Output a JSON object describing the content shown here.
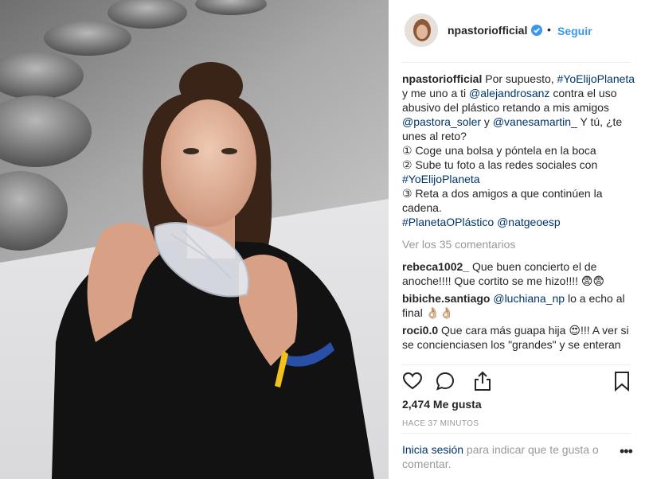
{
  "header": {
    "username": "npastoriofficial",
    "separator": "•",
    "follow_label": "Seguir"
  },
  "caption": {
    "username": "npastoriofficial",
    "text_1": " Por supuesto, ",
    "tag_1": "#YoElijoPlaneta",
    "text_2": " y me uno a ti ",
    "mention_1": "@alejandrosanz",
    "text_3": " contra el uso abusivo del plástico retando a mis amigos ",
    "mention_2": "@pastora_soler",
    "text_4": " y ",
    "mention_3": "@vanesamartin_",
    "text_5": " Y tú, ¿te unes al reto?",
    "step_1": "① Coge una bolsa y póntela en la boca",
    "step_2a": "② Sube tu foto a las redes sociales con ",
    "step_2_tag": "#YoElijoPlaneta",
    "step_3": "③ Reta a dos amigos a que continúen la cadena.",
    "tag_2": "#PlanetaOPlástico",
    "mention_4": "@natgeoesp"
  },
  "view_all_label": "Ver los 35 comentarios",
  "comments": [
    {
      "user": "rebeca1002_",
      "text": " Que buen concierto el de anoche!!!! Que cortito se me hizo!!!! 😨😨"
    },
    {
      "user": "bibiche.santiago",
      "mention": "@luchiana_np",
      "text": " lo a echo al final 👌🏼👌🏼"
    },
    {
      "user": "roci0.0",
      "text": " Que cara más guapa hija 😍!!! A ver si se concienciasen los \"grandes\" y se enteran"
    }
  ],
  "likes": "2,474 Me gusta",
  "time": "HACE 37 MINUTOS",
  "login": {
    "link": "Inicia sesión",
    "text": " para indicar que te gusta o comentar."
  },
  "more_label": "•••",
  "icons": {
    "like": "heart-icon",
    "comment": "comment-icon",
    "share": "share-icon",
    "save": "bookmark-icon"
  },
  "colors": {
    "accent": "#3897f0",
    "link": "#003569",
    "muted": "#999999",
    "verified": "#3897f0"
  }
}
